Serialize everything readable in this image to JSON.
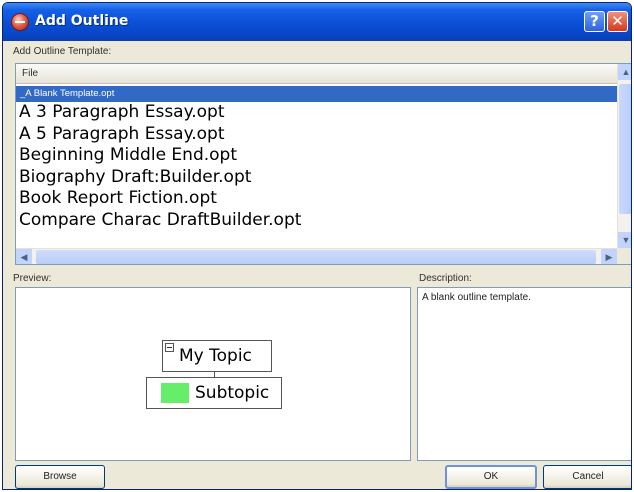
{
  "window": {
    "title": "Add Outline",
    "help_label": "?",
    "close_label": "✕"
  },
  "template_section": {
    "label": "Add Outline Template:",
    "column_header": "File",
    "files": [
      "_A Blank Template.opt",
      "A 3 Paragraph Essay.opt",
      "A 5 Paragraph Essay.opt",
      "Beginning Middle End.opt",
      "Biography Draft:Builder.opt",
      "Book Report Fiction.opt",
      "Compare Charac DraftBuilder.opt"
    ],
    "selected_index": 0,
    "scroll_icons": {
      "up": "▲",
      "down": "▼",
      "left": "◀",
      "right": "▶"
    }
  },
  "preview": {
    "label": "Preview:",
    "topic": "My Topic",
    "subtopic": "Subtopic",
    "subtopic_marker_color": "#66ee6a"
  },
  "description": {
    "label": "Description:",
    "text": "A blank outline template."
  },
  "buttons": {
    "browse": "Browse",
    "ok": "OK",
    "cancel": "Cancel"
  },
  "colors": {
    "titlebar": "#0a4fd6",
    "selection": "#316ac5",
    "dialog_bg": "#ece9d8"
  }
}
